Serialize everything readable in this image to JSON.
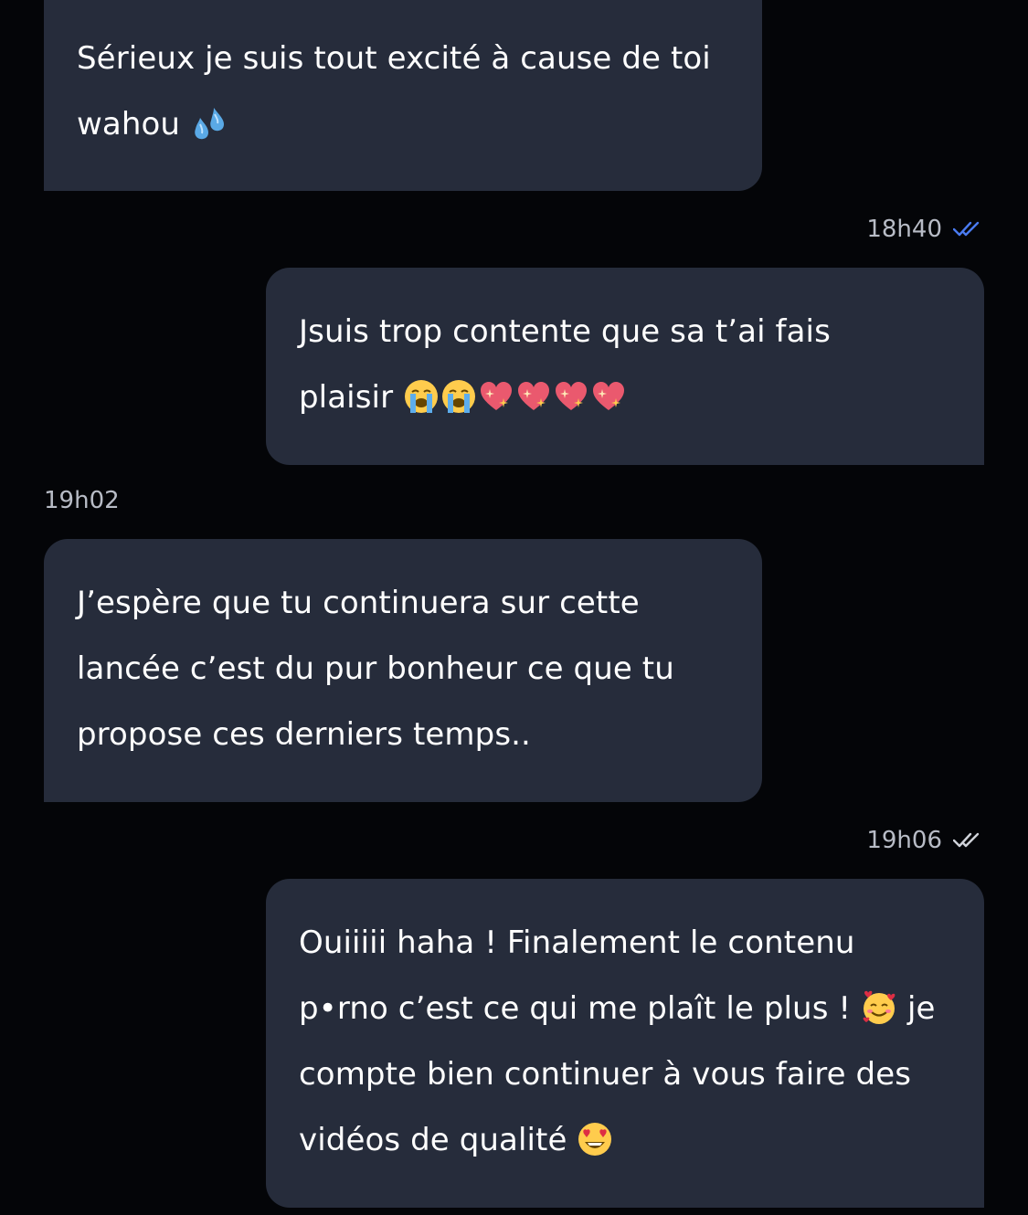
{
  "messages": [
    {
      "direction": "incoming",
      "lines": [
        "Sérieux je suis tout excité à cause de toi",
        "wahou"
      ],
      "emoji": [
        "sweat-droplets-icon"
      ]
    },
    {
      "direction": "outgoing",
      "time": "18h40",
      "read": true,
      "lines": [
        "Jsuis trop contente que sa t’ai fais",
        "plaisir"
      ],
      "emoji": [
        "loudly-crying-face-icon",
        "loudly-crying-face-icon",
        "sparkling-heart-icon",
        "sparkling-heart-icon",
        "sparkling-heart-icon",
        "sparkling-heart-icon"
      ]
    },
    {
      "direction": "incoming",
      "time": "19h02",
      "lines": [
        "J’espère que tu continuera sur cette",
        "lancée c’est du pur bonheur ce que tu",
        "propose ces derniers temps.."
      ]
    },
    {
      "direction": "outgoing",
      "time": "19h06",
      "read": false,
      "lines": [
        "Ouiiiii haha ! Finalement le contenu",
        "p•rno c’est ce qui me plaît le plus !",
        "je",
        "compte bien continuer à vous faire des",
        "vidéos de qualité"
      ],
      "emoji": [
        "smiling-face-with-hearts-icon",
        "heart-eyes-icon"
      ]
    }
  ],
  "colors": {
    "background": "#040508",
    "bubble": "#262c3b",
    "text": "#ffffff",
    "timestamp": "#b8bcc6",
    "read_check": "#4a7bf0",
    "sent_check": "#d0d3da"
  }
}
